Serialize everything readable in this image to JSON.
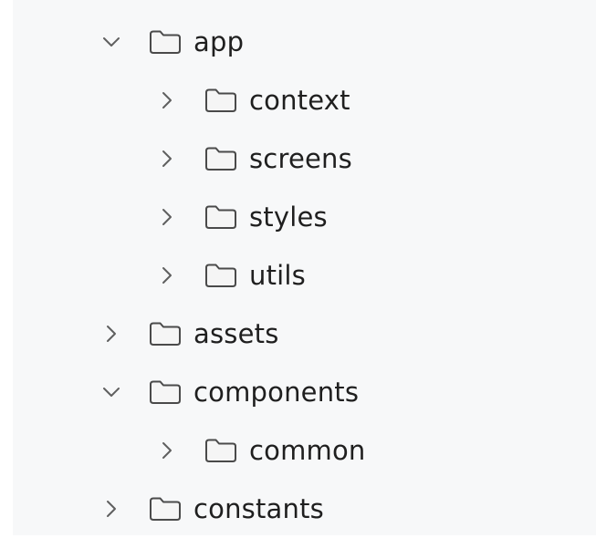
{
  "explorer": {
    "items": [
      {
        "label": "app",
        "depth": 0,
        "state": "expanded",
        "icon": "folder-icon"
      },
      {
        "label": "context",
        "depth": 1,
        "state": "collapsed",
        "icon": "folder-icon"
      },
      {
        "label": "screens",
        "depth": 1,
        "state": "collapsed",
        "icon": "folder-icon"
      },
      {
        "label": "styles",
        "depth": 1,
        "state": "collapsed",
        "icon": "folder-icon"
      },
      {
        "label": "utils",
        "depth": 1,
        "state": "collapsed",
        "icon": "folder-icon"
      },
      {
        "label": "assets",
        "depth": 0,
        "state": "collapsed",
        "icon": "folder-icon"
      },
      {
        "label": "components",
        "depth": 0,
        "state": "expanded",
        "icon": "folder-icon"
      },
      {
        "label": "common",
        "depth": 1,
        "state": "collapsed",
        "icon": "folder-icon"
      },
      {
        "label": "constants",
        "depth": 0,
        "state": "collapsed",
        "icon": "folder-icon"
      }
    ]
  },
  "colors": {
    "background": "#f7f8f9",
    "text": "#1f1f1f",
    "icon_stroke": "#4a4a4a",
    "chevron": "#5f5f5f"
  }
}
